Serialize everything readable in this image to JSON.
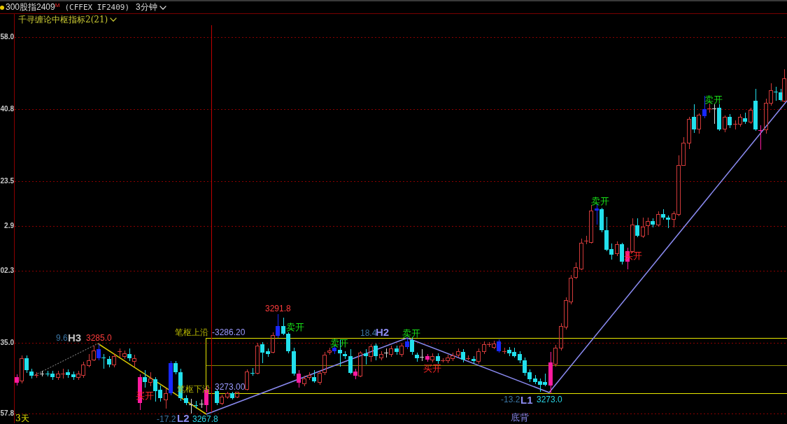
{
  "header": {
    "title": "300股指2409$^{M}$",
    "contract": "(CFFEX IF2409)",
    "period": "3分钟"
  },
  "indicator": {
    "name": "千寻缠论中枢指标2(21)"
  },
  "y_axis": {
    "labels": [
      "58.0",
      "40.8",
      "23.5",
      "2.9",
      "02.3",
      "35.0",
      "57.8"
    ]
  },
  "annotations": [
    {
      "kind": "high_price",
      "text": "3291.8"
    },
    {
      "kind": "zone_name",
      "text": "笔枢上沿"
    },
    {
      "kind": "zone_value",
      "text": "-3286.20"
    },
    {
      "kind": "delta",
      "text": "18.4"
    },
    {
      "kind": "pivot",
      "text": "H2"
    },
    {
      "kind": "delta",
      "text": "9.6"
    },
    {
      "kind": "pivot_prior",
      "text": "H3"
    },
    {
      "kind": "high_price",
      "text": "3285.0"
    },
    {
      "kind": "zone_name",
      "text": "笔枢下沿"
    },
    {
      "kind": "zone_value",
      "text": "3273.00"
    },
    {
      "kind": "delta",
      "text": "-13.2"
    },
    {
      "kind": "pivot",
      "text": "L1"
    },
    {
      "kind": "low_price",
      "text": "3273.0"
    },
    {
      "kind": "delta",
      "text": "-17.2"
    },
    {
      "kind": "pivot",
      "text": "L2"
    },
    {
      "kind": "low_price",
      "text": "3267.8"
    },
    {
      "kind": "divergence",
      "text": "底背"
    }
  ],
  "signals": [
    {
      "kind": "sell",
      "text": "卖开"
    },
    {
      "kind": "sell",
      "text": "卖开"
    },
    {
      "kind": "buy",
      "text": "买开"
    },
    {
      "kind": "sell",
      "text": "卖开"
    },
    {
      "kind": "sell",
      "text": "卖开"
    },
    {
      "kind": "sell",
      "text": "卖开"
    },
    {
      "kind": "buy",
      "text": "买开"
    },
    {
      "kind": "buy",
      "text": "买开"
    }
  ],
  "x_axis": {
    "label": "3天"
  }
}
